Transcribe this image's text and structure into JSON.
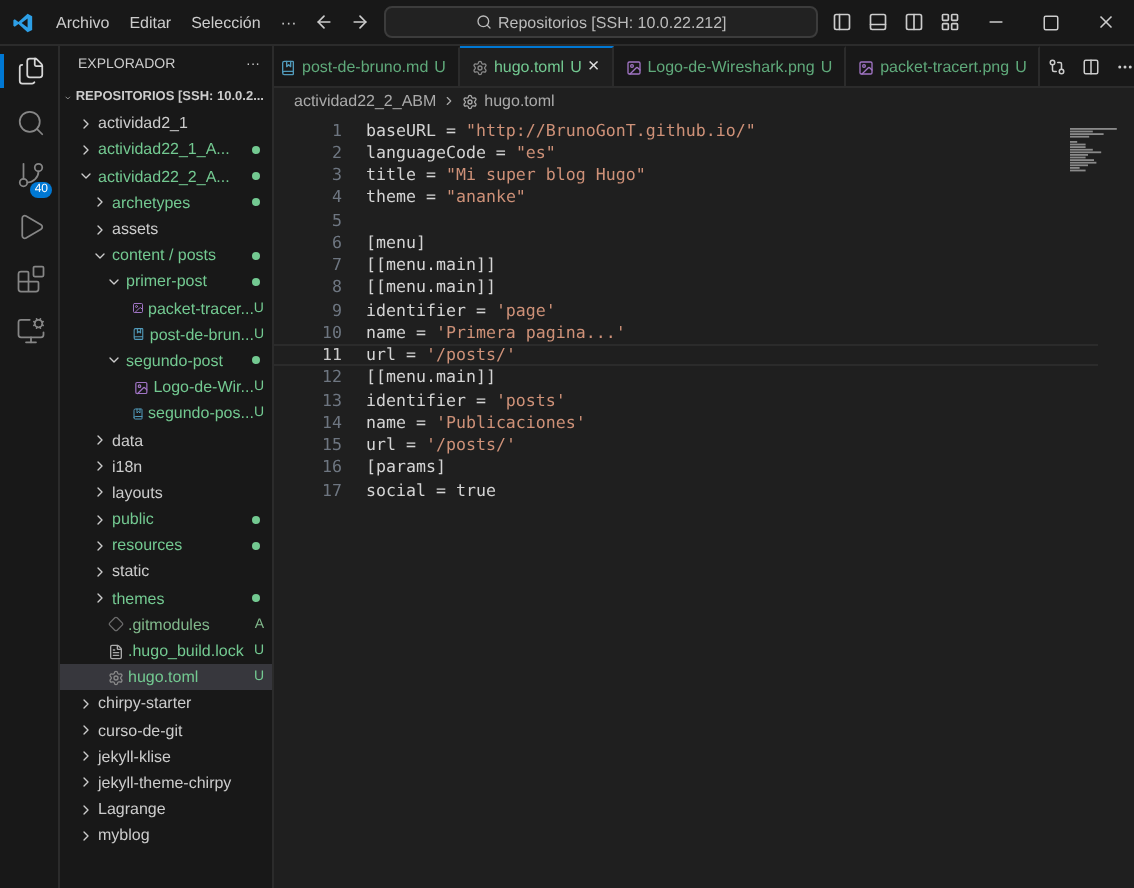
{
  "menu": [
    "Archivo",
    "Editar",
    "Selección",
    "···"
  ],
  "command_center": {
    "text": "Repositorios [SSH: 10.0.22.212]"
  },
  "activity_bar": {
    "items": [
      {
        "kind": "explorer",
        "selected": true
      },
      {
        "kind": "search",
        "selected": false
      },
      {
        "kind": "source-control",
        "selected": false,
        "badge": "40"
      },
      {
        "kind": "debug",
        "selected": false
      },
      {
        "kind": "extensions",
        "selected": false
      },
      {
        "kind": "remote",
        "selected": false
      }
    ]
  },
  "sidebar": {
    "title": "EXPLORADOR",
    "more": "···",
    "root": "REPOSITORIOS [SSH: 10.0.2...",
    "items": [
      {
        "label": "actividad2_1",
        "kind": "folder",
        "expanded": false
      },
      {
        "label": "actividad22_1_A...",
        "kind": "folder",
        "expanded": false,
        "dot": true,
        "color": "#73c991"
      },
      {
        "label": "actividad22_2_A...",
        "kind": "folder",
        "expanded": true,
        "dot": true,
        "color": "#73c991",
        "children": [
          {
            "label": "archetypes",
            "kind": "folder",
            "expanded": false,
            "dot": true,
            "color": "#73c991"
          },
          {
            "label": "assets",
            "kind": "folder",
            "expanded": false
          },
          {
            "label": "content / posts",
            "kind": "folder",
            "expanded": true,
            "dot": true,
            "color": "#73c991",
            "children": [
              {
                "label": "primer-post",
                "kind": "folder",
                "expanded": true,
                "dot": true,
                "color": "#73c991",
                "children": [
                  {
                    "label": "packet-tracer...",
                    "kind": "image",
                    "badge": "U",
                    "color": "#73c991"
                  },
                  {
                    "label": "post-de-brun...",
                    "kind": "markdown",
                    "badge": "U",
                    "color": "#73c991"
                  }
                ]
              },
              {
                "label": "segundo-post",
                "kind": "folder",
                "expanded": true,
                "dot": true,
                "color": "#73c991",
                "children": [
                  {
                    "label": "Logo-de-Wir...",
                    "kind": "image",
                    "badge": "U",
                    "color": "#73c991"
                  },
                  {
                    "label": "segundo-pos...",
                    "kind": "markdown",
                    "badge": "U",
                    "color": "#73c991"
                  }
                ]
              }
            ]
          },
          {
            "label": "data",
            "kind": "folder",
            "expanded": false
          },
          {
            "label": "i18n",
            "kind": "folder",
            "expanded": false
          },
          {
            "label": "layouts",
            "kind": "folder",
            "expanded": false
          },
          {
            "label": "public",
            "kind": "folder",
            "expanded": false,
            "dot": true,
            "color": "#73c991"
          },
          {
            "label": "resources",
            "kind": "folder",
            "expanded": false,
            "dot": true,
            "color": "#73c991"
          },
          {
            "label": "static",
            "kind": "folder",
            "expanded": false
          },
          {
            "label": "themes",
            "kind": "folder",
            "expanded": false,
            "dot": true,
            "color": "#73c991"
          },
          {
            "label": ".gitmodules",
            "kind": "git",
            "badge": "A",
            "color": "#81b88b"
          },
          {
            "label": ".hugo_build.lock",
            "kind": "text",
            "badge": "U",
            "color": "#73c991"
          },
          {
            "label": "hugo.toml",
            "kind": "settings",
            "badge": "U",
            "color": "#73c991",
            "selected": true
          }
        ]
      },
      {
        "label": "chirpy-starter",
        "kind": "folder",
        "expanded": false
      },
      {
        "label": "curso-de-git",
        "kind": "folder",
        "expanded": false
      },
      {
        "label": "jekyll-klise",
        "kind": "folder",
        "expanded": false
      },
      {
        "label": "jekyll-theme-chirpy",
        "kind": "folder",
        "expanded": false
      },
      {
        "label": "Lagrange",
        "kind": "folder",
        "expanded": false
      },
      {
        "label": "myblog",
        "kind": "folder",
        "expanded": false
      }
    ]
  },
  "tabs": [
    {
      "label": "post-de-bruno.md",
      "kind": "markdown",
      "badge": "U",
      "selected": false
    },
    {
      "label": "hugo.toml",
      "kind": "settings",
      "badge": "U",
      "close": "×",
      "selected": true
    },
    {
      "label": "Logo-de-Wireshark.png",
      "kind": "image",
      "badge": "U",
      "selected": false
    },
    {
      "label": "packet-tracert.png",
      "kind": "image",
      "badge": "U",
      "selected": false
    }
  ],
  "breadcrumb": [
    "actividad22_2_ABM",
    "hugo.toml"
  ],
  "editor": {
    "lines": [
      {
        "n": "1",
        "text": "baseURL = \"http://BrunoGonT.github.io/\"",
        "current": false
      },
      {
        "n": "2",
        "text": "languageCode = \"es\"",
        "current": false
      },
      {
        "n": "3",
        "text": "title = \"Mi super blog Hugo\"",
        "current": false
      },
      {
        "n": "4",
        "text": "theme = \"ananke\"",
        "current": false
      },
      {
        "n": "5",
        "current": false
      },
      {
        "n": "6",
        "text": "[menu]",
        "current": false
      },
      {
        "n": "7",
        "text": "[[menu.main]]",
        "current": false
      },
      {
        "n": "8",
        "text": "[[menu.main]]",
        "current": false
      },
      {
        "n": "9",
        "text": "identifier = 'page'",
        "current": false
      },
      {
        "n": "10",
        "text": "name = 'Primera pagina...'",
        "current": false
      },
      {
        "n": "11",
        "text": "url = '/posts/'",
        "current": true
      },
      {
        "n": "12",
        "text": "[[menu.main]]",
        "current": false
      },
      {
        "n": "13",
        "text": "identifier = 'posts'",
        "current": false
      },
      {
        "n": "14",
        "text": "name = 'Publicaciones'",
        "current": false
      },
      {
        "n": "15",
        "text": "url = '/posts/'",
        "current": false
      },
      {
        "n": "16",
        "text": "[params]",
        "current": false
      },
      {
        "n": "17",
        "text": "social = true",
        "current": false
      }
    ]
  }
}
